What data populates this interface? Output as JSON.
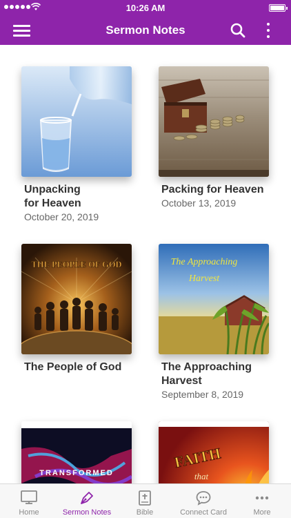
{
  "status_bar": {
    "time": "10:26 AM"
  },
  "header": {
    "title": "Sermon Notes"
  },
  "sermons": [
    {
      "title": "Unpacking\nfor Heaven",
      "date": "October 20, 2019",
      "image": "water-pouring-into-glass"
    },
    {
      "title": "Packing for Heaven",
      "date": "October 13, 2019",
      "image": "treasure-chest-with-coins"
    },
    {
      "title": "The People of God",
      "date": "",
      "image": "people-silhouettes-on-globe",
      "image_text": "THE PEOPLE OF GOD"
    },
    {
      "title": "The Approaching\nHarvest",
      "date": "September 8, 2019",
      "image": "cornfield-with-barn",
      "image_text": [
        "The Approaching",
        "Harvest"
      ]
    },
    {
      "title": "",
      "date": "",
      "image": "transformed-banner",
      "image_text": "TRANSFORMED"
    },
    {
      "title": "",
      "date": "",
      "image": "faith-flames-banner",
      "image_text": [
        "FAITH",
        "that"
      ]
    }
  ],
  "tab_bar": {
    "items": [
      {
        "label": "Home",
        "icon": "monitor-icon"
      },
      {
        "label": "Sermon Notes",
        "icon": "pen-icon",
        "active": true
      },
      {
        "label": "Bible",
        "icon": "bible-icon"
      },
      {
        "label": "Connect Card",
        "icon": "chat-bubble-icon"
      },
      {
        "label": "More",
        "icon": "ellipsis-icon"
      }
    ]
  },
  "colors": {
    "brand": "#8e24aa",
    "tab_inactive": "#8a8a8a"
  }
}
